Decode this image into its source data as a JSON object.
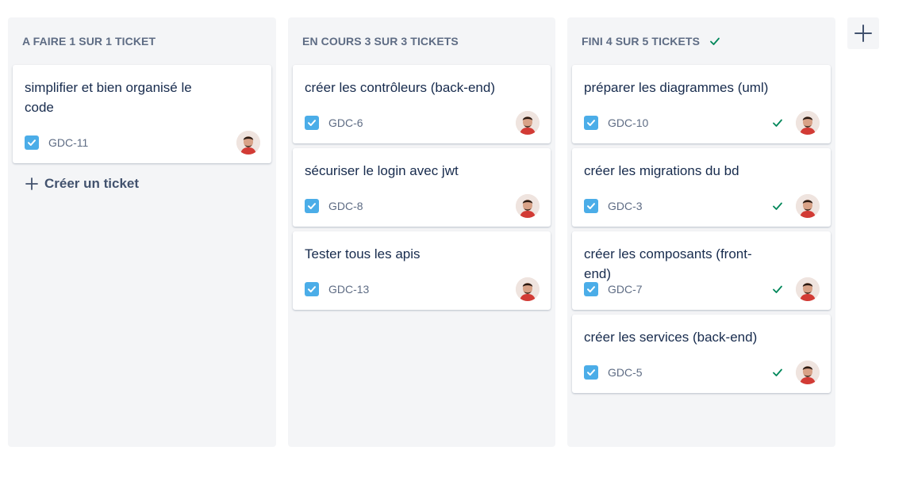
{
  "columns": [
    {
      "title": "A FAIRE 1 SUR 1 TICKET",
      "cards": [
        {
          "title": "simplifier et bien organisé le code",
          "key": "GDC-11",
          "done": false
        }
      ],
      "create_label": "Créer un ticket"
    },
    {
      "title": "EN COURS 3 SUR 3 TICKETS",
      "cards": [
        {
          "title": "créer les contrôleurs (back-end)",
          "key": "GDC-6",
          "done": false
        },
        {
          "title": "sécuriser le login avec jwt",
          "key": "GDC-8",
          "done": false
        },
        {
          "title": "Tester tous les apis",
          "key": "GDC-13",
          "done": false
        }
      ]
    },
    {
      "title": "FINI 4 SUR 5 TICKETS",
      "header_icon": "check-icon",
      "cards": [
        {
          "title": "préparer les diagrammes (uml)",
          "key": "GDC-10",
          "done": true
        },
        {
          "title": "créer les migrations du bd",
          "key": "GDC-3",
          "done": true
        },
        {
          "title": "créer les composants (front-end)",
          "key": "GDC-7",
          "done": true
        },
        {
          "title": "créer les services (back-end)",
          "key": "GDC-5",
          "done": true
        }
      ]
    }
  ],
  "add_column_icon": "plus-icon",
  "colors": {
    "column_bg": "#f4f5f7",
    "checkbox": "#4bade8",
    "done_check": "#00875a",
    "text": "#172b4d",
    "muted": "#5e6c84"
  }
}
